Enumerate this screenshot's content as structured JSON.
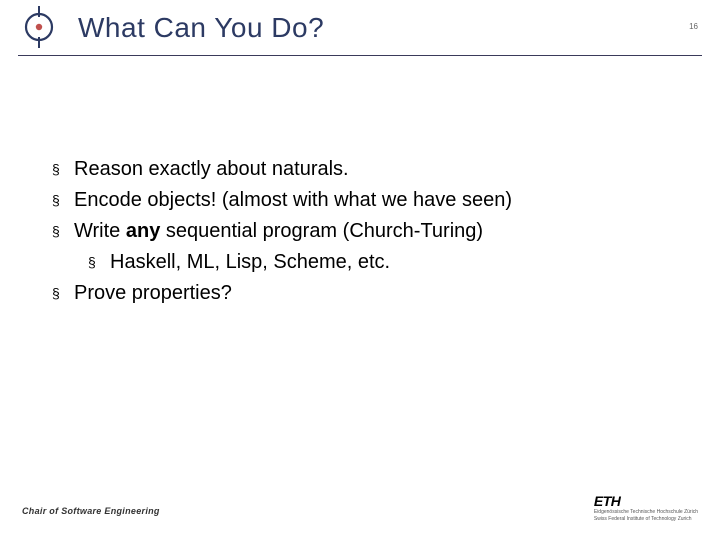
{
  "header": {
    "title": "What Can You Do?",
    "page_number": "16"
  },
  "bullets": [
    {
      "segments": [
        {
          "t": "Reason exactly about naturals."
        }
      ],
      "sub": []
    },
    {
      "segments": [
        {
          "t": "Encode objects! (almost with what we have seen)"
        }
      ],
      "sub": []
    },
    {
      "segments": [
        {
          "t": "Write "
        },
        {
          "t": "any",
          "bold": true
        },
        {
          "t": " sequential program (Church-Turing)"
        }
      ],
      "sub": [
        {
          "segments": [
            {
              "t": "Haskell, ML, Lisp, Scheme, etc."
            }
          ]
        }
      ]
    },
    {
      "segments": [
        {
          "t": "Prove properties?"
        }
      ],
      "sub": []
    }
  ],
  "footer": {
    "left": "Chair of Software Engineering",
    "eth": "ETH",
    "sub1": "Eidgenössische Technische Hochschule Zürich",
    "sub2": "Swiss Federal Institute of Technology Zurich"
  },
  "marker": "§"
}
